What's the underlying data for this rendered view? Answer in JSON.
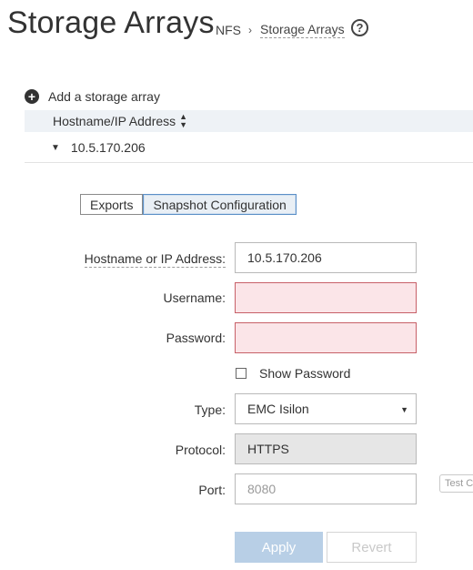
{
  "header": {
    "title": "Storage Arrays",
    "breadcrumb": {
      "root": "NFS",
      "separator": "›",
      "current": "Storage Arrays"
    },
    "help_icon_glyph": "?"
  },
  "add_array": {
    "icon": "plus-circle-icon",
    "label": "Add a storage array"
  },
  "table": {
    "columns": [
      {
        "label": "Hostname/IP Address",
        "sortable": true
      }
    ],
    "rows": [
      {
        "hostname": "10.5.170.206",
        "expanded": true
      }
    ]
  },
  "tabs": [
    {
      "label": "Exports",
      "active": false
    },
    {
      "label": "Snapshot Configuration",
      "active": true
    }
  ],
  "form": {
    "hostname": {
      "label": "Hostname or IP Address:",
      "value": "10.5.170.206"
    },
    "username": {
      "label": "Username:",
      "value": "",
      "state": "error"
    },
    "password": {
      "label": "Password:",
      "value": "",
      "state": "error"
    },
    "show_password": {
      "label": "Show Password",
      "checked": false
    },
    "type": {
      "label": "Type:",
      "value": "EMC Isilon"
    },
    "protocol": {
      "label": "Protocol:",
      "value": "HTTPS"
    },
    "port": {
      "label": "Port:",
      "placeholder": "8080"
    },
    "test_button_label": "Test C"
  },
  "actions": {
    "apply_label": "Apply",
    "revert_label": "Revert"
  },
  "colors": {
    "error_fill": "#fbe5e8",
    "error_border": "#c76068",
    "active_tab_fill": "#e9eff5",
    "apply_disabled": "#b8cfe6"
  }
}
